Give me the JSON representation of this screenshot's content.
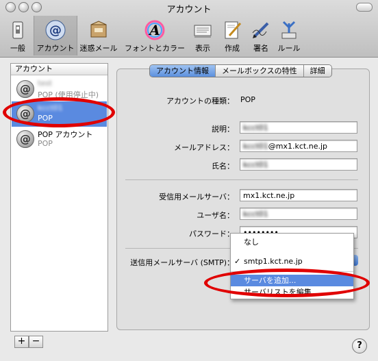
{
  "window": {
    "title": "アカウント"
  },
  "toolbar": {
    "items": [
      {
        "label": "一般",
        "icon": "switch-icon"
      },
      {
        "label": "アカウント",
        "icon": "at-sign-icon"
      },
      {
        "label": "迷惑メール",
        "icon": "junk-mail-icon"
      },
      {
        "label": "フォントとカラー",
        "icon": "font-color-icon"
      },
      {
        "label": "表示",
        "icon": "view-icon"
      },
      {
        "label": "作成",
        "icon": "compose-icon"
      },
      {
        "label": "署名",
        "icon": "signature-icon"
      },
      {
        "label": "ルール",
        "icon": "rules-icon"
      }
    ]
  },
  "sidebar": {
    "header": "アカウント",
    "accounts": [
      {
        "name": "test",
        "type": "POP (使用停止中)",
        "disabled": true
      },
      {
        "name": "kcct01",
        "type": "POP",
        "selected": true
      },
      {
        "name": "POP アカウント",
        "type": "POP"
      }
    ],
    "add_label": "+",
    "remove_label": "−"
  },
  "tabs": [
    "アカウント情報",
    "メールボックスの特性",
    "詳細"
  ],
  "form": {
    "account_type_label": "アカウントの種類：",
    "account_type_value": "POP",
    "description_label": "説明：",
    "description_value": "kcct01",
    "email_label": "メールアドレス：",
    "email_local": "kcct01",
    "email_domain": "@mx1.kct.ne.jp",
    "fullname_label": "氏名：",
    "fullname_value": "kcct01",
    "incoming_label": "受信用メールサーバ：",
    "incoming_value": "mx1.kct.ne.jp",
    "username_label": "ユーザ名：",
    "username_value": "kcct01",
    "password_label": "パスワード：",
    "password_value": "••••••••",
    "outgoing_label": "送信用メールサーバ (SMTP)："
  },
  "smtp_menu": {
    "items": [
      "なし",
      "smtp1.kct.ne.jp",
      "サーバを追加...",
      "サーバリストを編集..."
    ],
    "checked_index": 1,
    "highlighted_index": 2
  },
  "colors": {
    "selection": "#5a8ae0",
    "annotation": "#e00000"
  },
  "help_label": "?"
}
